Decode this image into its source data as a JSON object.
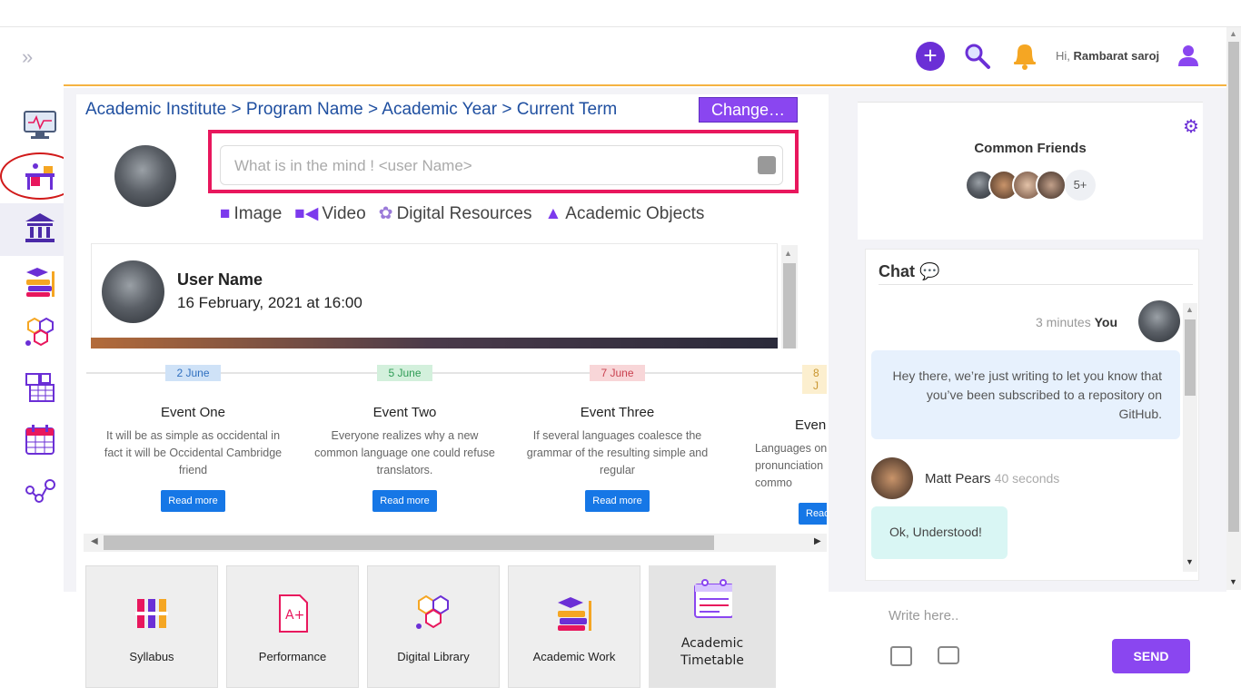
{
  "header": {
    "greeting": "Hi,",
    "user": "Rambarat saroj"
  },
  "breadcrumb": "Academic Institute > Program Name > Academic Year > Current Term",
  "change_button": "Change…",
  "post": {
    "placeholder": "What is in the mind ! <user Name>",
    "tabs": [
      "Image",
      "Video",
      "Digital Resources",
      "Academic Objects"
    ]
  },
  "feed": {
    "user_name": "User Name",
    "date": "16 February, 2021 at 16:00"
  },
  "events": [
    {
      "date": "2 June",
      "title": "Event One",
      "desc": "It will be as simple as occidental in fact it will be Occidental Cambridge friend",
      "button": "Read more",
      "date_bg": "#cfe2f7",
      "date_color": "#2f6fbf"
    },
    {
      "date": "5 June",
      "title": "Event Two",
      "desc": "Everyone realizes why a new common language one could refuse translators.",
      "button": "Read more",
      "date_bg": "#d3f0dc",
      "date_color": "#2e9c55"
    },
    {
      "date": "7 June",
      "title": "Event Three",
      "desc": "If several languages coalesce the grammar of the resulting simple and regular",
      "button": "Read more",
      "date_bg": "#f8d6d8",
      "date_color": "#c9414f"
    },
    {
      "date": "8 J",
      "title": "Even",
      "desc": "Languages on pronunciation commo",
      "button": "Read",
      "date_bg": "#fcefcf",
      "date_color": "#c9962f"
    }
  ],
  "tiles": [
    "Syllabus",
    "Performance",
    "Digital Library",
    "Academic Work",
    "Academic Timetable"
  ],
  "friends": {
    "title": "Common Friends",
    "more": "5+"
  },
  "chat": {
    "title": "Chat",
    "msg1_time": "3 minutes",
    "msg1_who": "You",
    "msg1_text": "Hey there, we’re just writing to let you know that you’ve been subscribed to a repository on GitHub.",
    "msg2_name": "Matt Pears",
    "msg2_time": "40 seconds",
    "msg2_text": "Ok, Understood!",
    "input_placeholder": "Write here..",
    "send": "SEND"
  }
}
